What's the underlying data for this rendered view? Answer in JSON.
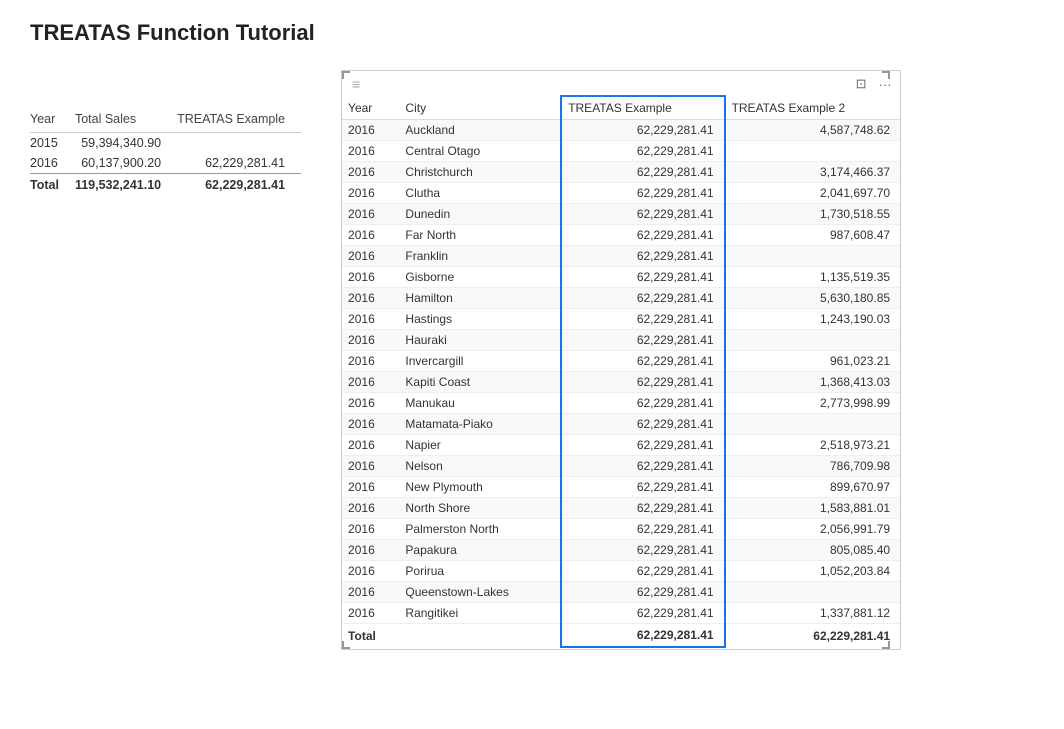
{
  "page": {
    "title": "TREATAS Function Tutorial"
  },
  "left_table": {
    "headers": [
      "Year",
      "Total Sales",
      "TREATAS Example"
    ],
    "rows": [
      {
        "year": "2015",
        "total_sales": "59,394,340.90",
        "treatas": ""
      },
      {
        "year": "2016",
        "total_sales": "60,137,900.20",
        "treatas": "62,229,281.41"
      }
    ],
    "total_row": {
      "label": "Total",
      "total_sales": "119,532,241.10",
      "treatas": "62,229,281.41"
    }
  },
  "right_table": {
    "headers": [
      "Year",
      "City",
      "TREATAS Example",
      "TREATAS Example 2"
    ],
    "rows": [
      {
        "year": "2016",
        "city": "Auckland",
        "treatas": "62,229,281.41",
        "treatas2": "4,587,748.62"
      },
      {
        "year": "2016",
        "city": "Central Otago",
        "treatas": "62,229,281.41",
        "treatas2": ""
      },
      {
        "year": "2016",
        "city": "Christchurch",
        "treatas": "62,229,281.41",
        "treatas2": "3,174,466.37"
      },
      {
        "year": "2016",
        "city": "Clutha",
        "treatas": "62,229,281.41",
        "treatas2": "2,041,697.70"
      },
      {
        "year": "2016",
        "city": "Dunedin",
        "treatas": "62,229,281.41",
        "treatas2": "1,730,518.55"
      },
      {
        "year": "2016",
        "city": "Far North",
        "treatas": "62,229,281.41",
        "treatas2": "987,608.47"
      },
      {
        "year": "2016",
        "city": "Franklin",
        "treatas": "62,229,281.41",
        "treatas2": ""
      },
      {
        "year": "2016",
        "city": "Gisborne",
        "treatas": "62,229,281.41",
        "treatas2": "1,135,519.35"
      },
      {
        "year": "2016",
        "city": "Hamilton",
        "treatas": "62,229,281.41",
        "treatas2": "5,630,180.85"
      },
      {
        "year": "2016",
        "city": "Hastings",
        "treatas": "62,229,281.41",
        "treatas2": "1,243,190.03"
      },
      {
        "year": "2016",
        "city": "Hauraki",
        "treatas": "62,229,281.41",
        "treatas2": ""
      },
      {
        "year": "2016",
        "city": "Invercargill",
        "treatas": "62,229,281.41",
        "treatas2": "961,023.21"
      },
      {
        "year": "2016",
        "city": "Kapiti Coast",
        "treatas": "62,229,281.41",
        "treatas2": "1,368,413.03"
      },
      {
        "year": "2016",
        "city": "Manukau",
        "treatas": "62,229,281.41",
        "treatas2": "2,773,998.99"
      },
      {
        "year": "2016",
        "city": "Matamata-Piako",
        "treatas": "62,229,281.41",
        "treatas2": ""
      },
      {
        "year": "2016",
        "city": "Napier",
        "treatas": "62,229,281.41",
        "treatas2": "2,518,973.21"
      },
      {
        "year": "2016",
        "city": "Nelson",
        "treatas": "62,229,281.41",
        "treatas2": "786,709.98"
      },
      {
        "year": "2016",
        "city": "New Plymouth",
        "treatas": "62,229,281.41",
        "treatas2": "899,670.97"
      },
      {
        "year": "2016",
        "city": "North Shore",
        "treatas": "62,229,281.41",
        "treatas2": "1,583,881.01"
      },
      {
        "year": "2016",
        "city": "Palmerston North",
        "treatas": "62,229,281.41",
        "treatas2": "2,056,991.79"
      },
      {
        "year": "2016",
        "city": "Papakura",
        "treatas": "62,229,281.41",
        "treatas2": "805,085.40"
      },
      {
        "year": "2016",
        "city": "Porirua",
        "treatas": "62,229,281.41",
        "treatas2": "1,052,203.84"
      },
      {
        "year": "2016",
        "city": "Queenstown-Lakes",
        "treatas": "62,229,281.41",
        "treatas2": ""
      },
      {
        "year": "2016",
        "city": "Rangitikei",
        "treatas": "62,229,281.41",
        "treatas2": "1,337,881.12"
      }
    ],
    "total_row": {
      "label": "Total",
      "treatas": "62,229,281.41",
      "treatas2": "62,229,281.41"
    }
  }
}
